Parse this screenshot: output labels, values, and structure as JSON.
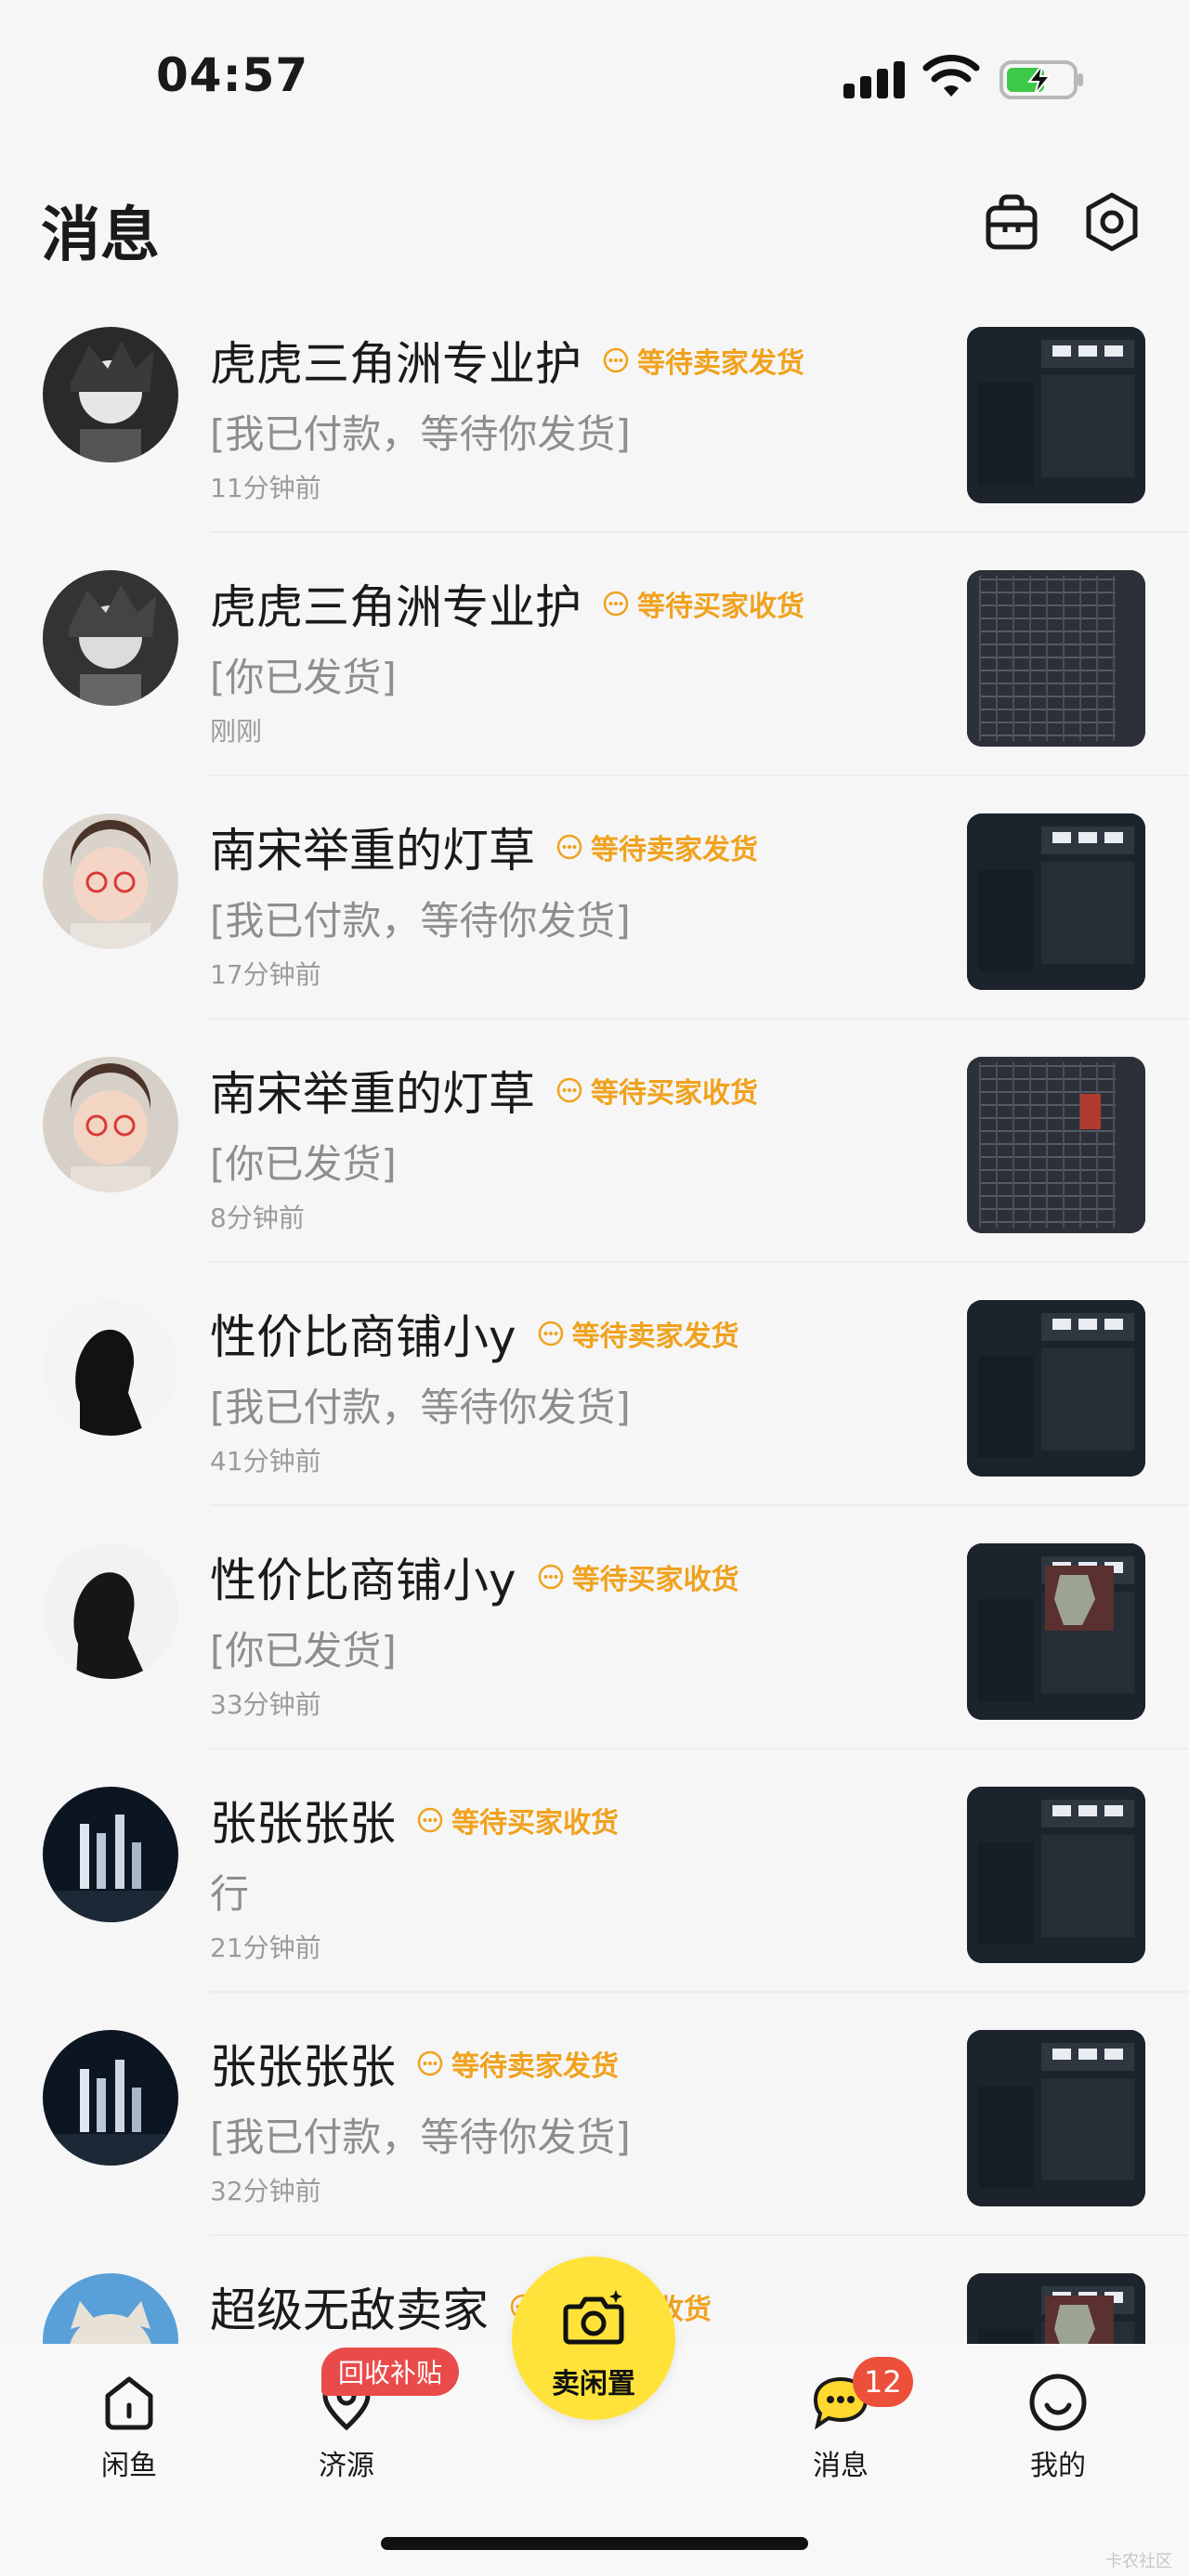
{
  "status_bar": {
    "time": "04:57",
    "icons": [
      "signal-icon",
      "wifi-icon",
      "battery-charging-icon"
    ]
  },
  "header": {
    "title": "消息",
    "icons": [
      "shopping-bag-icon",
      "settings-hexagon-icon"
    ]
  },
  "conversations": [
    {
      "name": "虎虎三角洲专业护",
      "status": "等待卖家发货",
      "preview": "[我已付款，等待你发货]",
      "time": "11分钟前"
    },
    {
      "name": "虎虎三角洲专业护",
      "status": "等待买家收货",
      "preview": "[你已发货]",
      "time": "刚刚"
    },
    {
      "name": "南宋举重的灯草",
      "status": "等待卖家发货",
      "preview": "[我已付款，等待你发货]",
      "time": "17分钟前"
    },
    {
      "name": "南宋举重的灯草",
      "status": "等待买家收货",
      "preview": "[你已发货]",
      "time": "8分钟前"
    },
    {
      "name": "性价比商铺小y",
      "status": "等待卖家发货",
      "preview": "[我已付款，等待你发货]",
      "time": "41分钟前"
    },
    {
      "name": "性价比商铺小y",
      "status": "等待买家收货",
      "preview": "[你已发货]",
      "time": "33分钟前"
    },
    {
      "name": "张张张张",
      "status": "等待买家收货",
      "preview": "行",
      "time": "21分钟前"
    },
    {
      "name": "张张张张",
      "status": "等待卖家发货",
      "preview": "[我已付款，等待你发货]",
      "time": "32分钟前"
    },
    {
      "name": "超级无敌卖家",
      "status": "等待买家收货",
      "preview": "",
      "time": ""
    }
  ],
  "tab_bar": {
    "tabs": [
      {
        "label": "闲鱼",
        "icon": "home-icon"
      },
      {
        "label": "济源",
        "icon": "location-icon"
      },
      {
        "label": "消息",
        "icon": "chat-icon"
      },
      {
        "label": "我的",
        "icon": "smile-icon"
      }
    ],
    "sell_label": "卖闲置",
    "recycle_badge": "回收补贴",
    "message_count": "12"
  },
  "watermark": "卡农社区",
  "colors": {
    "accent_yellow": "#ffe33a",
    "status_orange": "#f0a21e",
    "badge_red": "#ec4f3a",
    "background": "#f6f6f6"
  }
}
